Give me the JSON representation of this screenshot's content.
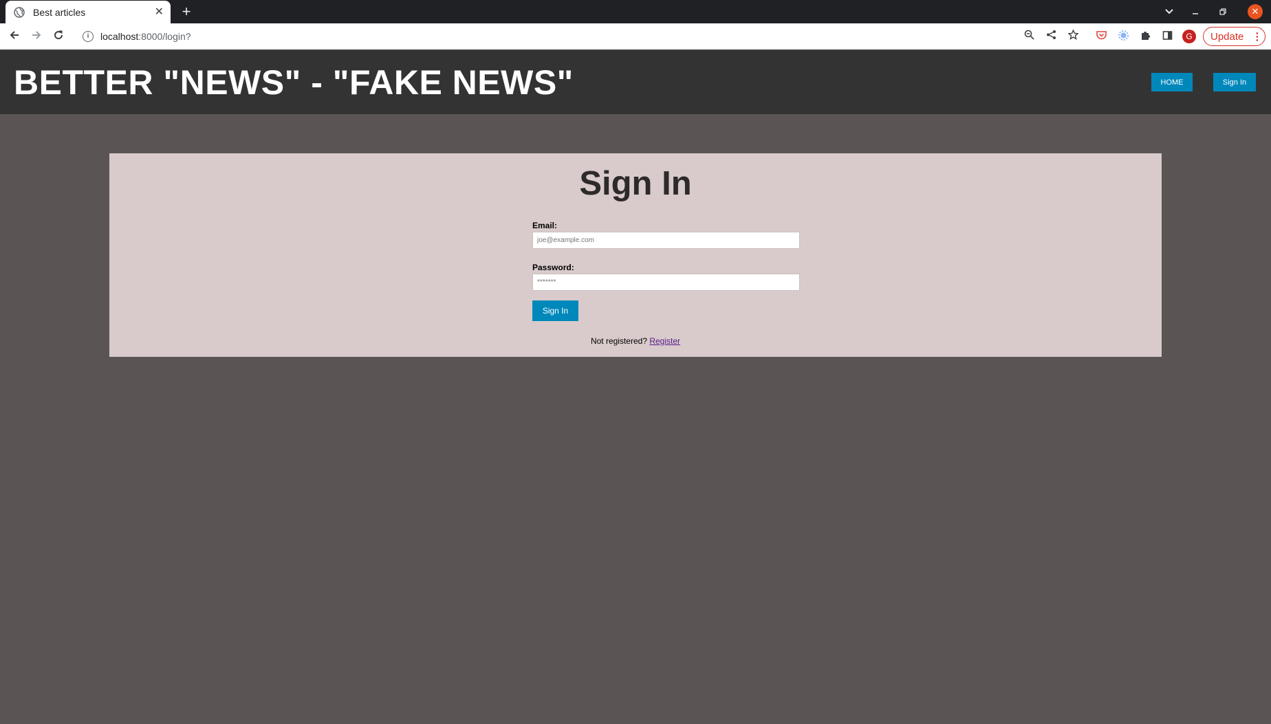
{
  "browser": {
    "tab_title": "Best articles",
    "tab_close": "✕",
    "new_tab": "+",
    "url_host": "localhost",
    "url_path": ":8000/login?",
    "info_icon": "i",
    "update_label": "Update",
    "avatar_letter": "G",
    "close_glyph": "✕"
  },
  "site": {
    "title": "BETTER \"NEWS\" - \"FAKE NEWS\"",
    "nav": {
      "home": "HOME",
      "sign_in": "Sign In"
    }
  },
  "login": {
    "heading": "Sign In",
    "email_label": "Email:",
    "email_placeholder": "joe@example.com",
    "password_label": "Password:",
    "password_placeholder": "*******",
    "submit": "Sign In",
    "not_registered": "Not registered? ",
    "register_link": "Register"
  },
  "colors": {
    "page_bg": "#5a5455",
    "header_bg": "#333333",
    "card_bg": "#d9cbcb",
    "accent": "#0088bb"
  }
}
